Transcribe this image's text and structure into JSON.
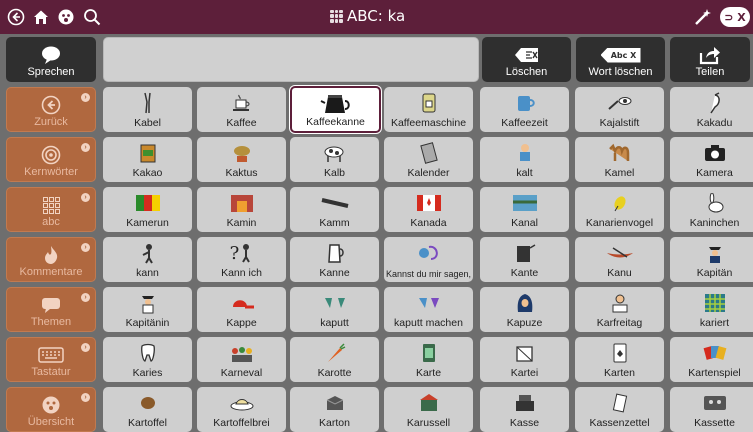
{
  "topbar": {
    "title": "ABC: ka",
    "icons": [
      "back-icon",
      "home-icon",
      "face-icon",
      "search-icon",
      "magic-wand-icon",
      "toggle-icon"
    ],
    "toggle_label": "⊃ X"
  },
  "toolbar": {
    "speak": "Sprechen",
    "delete": "Löschen",
    "delete_word": "Wort löschen",
    "delete_word_icon_text": "Abc X",
    "share": "Teilen"
  },
  "sidebar": [
    {
      "label": "Zurück",
      "icon": "back-arrow-icon"
    },
    {
      "label": "Kernwörter",
      "icon": "target-icon"
    },
    {
      "label": "abc",
      "icon": "letters-icon"
    },
    {
      "label": "Kommentare",
      "icon": "flame-icon"
    },
    {
      "label": "Themen",
      "icon": "speech-bubble-icon"
    },
    {
      "label": "Tastatur",
      "icon": "keyboard-icon"
    },
    {
      "label": "Übersicht",
      "icon": "overview-icon"
    }
  ],
  "grid": [
    [
      "Kabel",
      "Kaffee",
      "Kaffeekanne",
      "Kaffeemaschine",
      "Kaffeezeit",
      "Kajalstift",
      "Kakadu"
    ],
    [
      "Kakao",
      "Kaktus",
      "Kalb",
      "Kalender",
      "kalt",
      "Kamel",
      "Kamera"
    ],
    [
      "Kamerun",
      "Kamin",
      "Kamm",
      "Kanada",
      "Kanal",
      "Kanarienvogel",
      "Kaninchen"
    ],
    [
      "kann",
      "Kann ich",
      "Kanne",
      "Kannst du mir sagen,",
      "Kante",
      "Kanu",
      "Kapitän"
    ],
    [
      "Kapitänin",
      "Kappe",
      "kaputt",
      "kaputt machen",
      "Kapuze",
      "Karfreitag",
      "kariert"
    ],
    [
      "Karies",
      "Karneval",
      "Karotte",
      "Karte",
      "Kartei",
      "Karten",
      "Kartenspiel"
    ],
    [
      "Kartoffel",
      "Kartoffelbrei",
      "Karton",
      "Karussell",
      "Kasse",
      "Kassenzettel",
      "Kassette"
    ]
  ],
  "selected_cell": "Kaffeekanne",
  "colors": {
    "topbar": "#5d1f3a",
    "sidebar": "#b0683f",
    "cell": "#cfcfcf",
    "toolbar": "#2f2f2f"
  }
}
